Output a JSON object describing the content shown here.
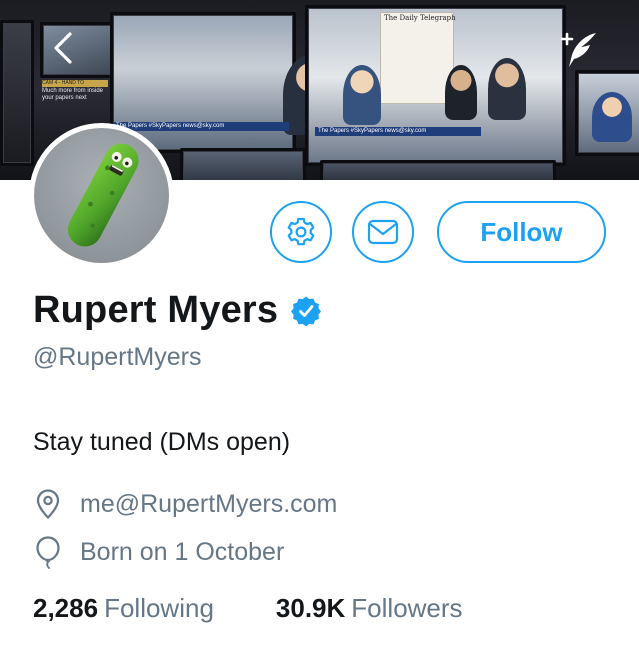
{
  "header": {
    "banner_name": "header-banner",
    "back_icon": "chevron-left-icon",
    "compose_icon": "compose-tweet-icon",
    "banner_text": {
      "newspaper_masthead": "The Daily Telegraph",
      "ticker_1": "The Papers  #SkyPapers  news@sky.com",
      "ticker_2": "The Papers  #SkyPapers  news@sky.com",
      "side_label": "CAM 4 - HAND TO",
      "side_text": "Much more from inside your papers next"
    }
  },
  "profile": {
    "display_name": "Rupert Myers",
    "verified": true,
    "handle": "@RupertMyers",
    "bio": "Stay tuned (DMs open)",
    "website": "me@RupertMyers.com",
    "birthday": "Born on 1 October",
    "avatar": "pickle-avatar"
  },
  "actions": {
    "settings_icon": "gear-icon",
    "message_icon": "envelope-icon",
    "follow_label": "Follow"
  },
  "stats": {
    "following_count": "2,286",
    "following_label": "Following",
    "followers_count": "30.9K",
    "followers_label": "Followers"
  },
  "colors": {
    "accent": "#1da1f2",
    "text_primary": "#14171a",
    "text_secondary": "#657786"
  }
}
